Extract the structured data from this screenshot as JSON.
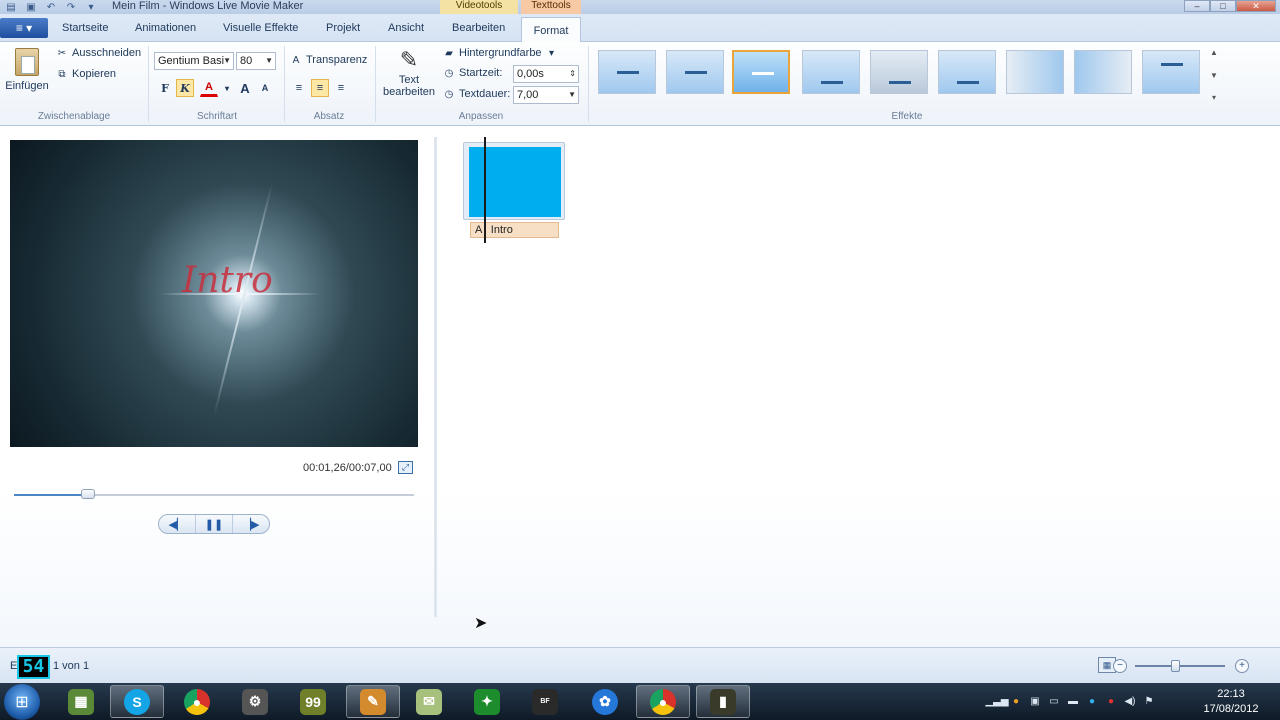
{
  "window": {
    "title": "Mein Film - Windows Live Movie Maker",
    "context_tabs": {
      "video": "Videotools",
      "text": "Texttools"
    },
    "controls": {
      "minimize": "–",
      "maximize": "□",
      "close": "✕"
    }
  },
  "quick_access": {
    "save_icon": "save-icon",
    "undo_icon": "undo-icon",
    "redo_icon": "redo-icon",
    "menu_icon": "qat-dropdown-icon"
  },
  "tabs": {
    "file_menu": "≡ ▾",
    "items": [
      "Startseite",
      "Animationen",
      "Visuelle Effekte",
      "Projekt",
      "Ansicht",
      "Bearbeiten"
    ],
    "active": "Format"
  },
  "ribbon": {
    "clipboard": {
      "paste": "Einfügen",
      "cut": "Ausschneiden",
      "copy": "Kopieren",
      "label": "Zwischenablage"
    },
    "font": {
      "family": "Gentium Basi",
      "size": "80",
      "bold": "F",
      "italic": "K",
      "color": "A",
      "grow": "A",
      "shrink": "A",
      "label": "Schriftart"
    },
    "paragraph": {
      "transparency": "Transparenz",
      "label": "Absatz"
    },
    "adjust": {
      "edit_text": "Text bearbeiten",
      "background_color": "Hintergrundfarbe",
      "start_time_label": "Startzeit:",
      "start_time_value": "0,00s",
      "duration_label": "Textdauer:",
      "duration_value": "7,00",
      "label": "Anpassen"
    },
    "effects": {
      "label": "Effekte",
      "selected_index": 2,
      "count": 9
    }
  },
  "preview": {
    "overlay_text": "Intro",
    "time": "00:01,26/00:07,00",
    "seek_progress": 0.185,
    "controls": {
      "prev": "◀▏",
      "pause": "❚❚",
      "next": "▕▶"
    }
  },
  "storyboard": {
    "clip_caption_prefix": "A",
    "clip_caption": "Intro"
  },
  "status": {
    "letter": "E",
    "text": "1 von 1",
    "overlay_logo": "54",
    "zoom_level": 0.44
  },
  "taskbar": {
    "start_icon": "windows-start-icon",
    "apps": [
      "minecraft",
      "skype",
      "chrome",
      "steam",
      "mugen",
      "movie-maker",
      "notes",
      "razer",
      "battlefield",
      "vlc-alt",
      "chrome-2",
      "camera-app"
    ],
    "clock_time": "22:13",
    "clock_date": "17/08/2012"
  },
  "colors": {
    "ribbon_accent": "#1e395b",
    "clip_fill": "#00adef",
    "text_overlay": "#c8303e",
    "context_video": "#f4e2a4",
    "context_text": "#f7c9a4"
  }
}
